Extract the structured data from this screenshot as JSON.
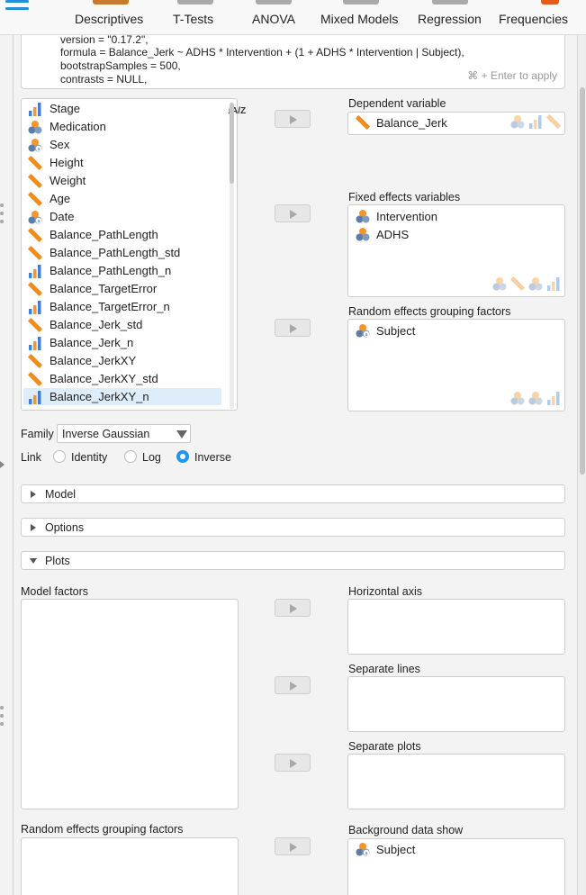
{
  "toolbar": {
    "items": [
      {
        "label": "Descriptives"
      },
      {
        "label": "T-Tests"
      },
      {
        "label": "ANOVA"
      },
      {
        "label": "Mixed Models"
      },
      {
        "label": "Regression"
      },
      {
        "label": "Frequencies"
      }
    ]
  },
  "syntax": {
    "lines": [
      "version = \"0.17.2\",",
      "formula = Balance_Jerk ~ ADHS * Intervention + (1 + ADHS * Intervention | Subject),",
      "bootstrapSamples = 500,",
      "contrasts = NULL,"
    ],
    "apply_hint": "⌘ + Enter to apply"
  },
  "variables": [
    {
      "name": "Stage",
      "type": "ordinal"
    },
    {
      "name": "Medication",
      "type": "nominal"
    },
    {
      "name": "Sex",
      "type": "nominal-text"
    },
    {
      "name": "Height",
      "type": "scale"
    },
    {
      "name": "Weight",
      "type": "scale"
    },
    {
      "name": "Age",
      "type": "scale"
    },
    {
      "name": "Date",
      "type": "nominal-text"
    },
    {
      "name": "Balance_PathLength",
      "type": "scale"
    },
    {
      "name": "Balance_PathLength_std",
      "type": "scale"
    },
    {
      "name": "Balance_PathLength_n",
      "type": "ordinal"
    },
    {
      "name": "Balance_TargetError",
      "type": "scale"
    },
    {
      "name": "Balance_TargetError_n",
      "type": "ordinal"
    },
    {
      "name": "Balance_Jerk_std",
      "type": "scale"
    },
    {
      "name": "Balance_Jerk_n",
      "type": "ordinal"
    },
    {
      "name": "Balance_JerkXY",
      "type": "scale"
    },
    {
      "name": "Balance_JerkXY_std",
      "type": "scale"
    },
    {
      "name": "Balance_JerkXY_n",
      "type": "ordinal",
      "selected": true
    }
  ],
  "sort_icon": "↓A/Z",
  "dependent": {
    "label": "Dependent variable",
    "items": [
      {
        "name": "Balance_Jerk",
        "type": "scale"
      }
    ]
  },
  "fixed": {
    "label": "Fixed effects variables",
    "items": [
      {
        "name": "Intervention",
        "type": "nominal"
      },
      {
        "name": "ADHS",
        "type": "nominal"
      }
    ]
  },
  "random": {
    "label": "Random effects grouping factors",
    "items": [
      {
        "name": "Subject",
        "type": "nominal-text"
      }
    ]
  },
  "family": {
    "label": "Family",
    "value": "Inverse Gaussian"
  },
  "link": {
    "label": "Link",
    "options": [
      {
        "label": "Identity",
        "checked": false
      },
      {
        "label": "Log",
        "checked": false
      },
      {
        "label": "Inverse",
        "checked": true
      }
    ]
  },
  "sections": [
    {
      "title": "Model",
      "expanded": false
    },
    {
      "title": "Options",
      "expanded": false
    },
    {
      "title": "Plots",
      "expanded": true
    }
  ],
  "plots": {
    "model_factors": "Model factors",
    "horizontal_axis": "Horizontal axis",
    "separate_lines": "Separate lines",
    "separate_plots": "Separate plots",
    "random_factors": "Random effects grouping factors",
    "background_show": "Background data show",
    "background_items": [
      {
        "name": "Subject",
        "type": "nominal-text"
      }
    ]
  },
  "colors": {
    "accent": "#2196f3",
    "ordinal": "#3f7fd9",
    "nominal": "#f4962a",
    "scale": "#f08b1d"
  }
}
